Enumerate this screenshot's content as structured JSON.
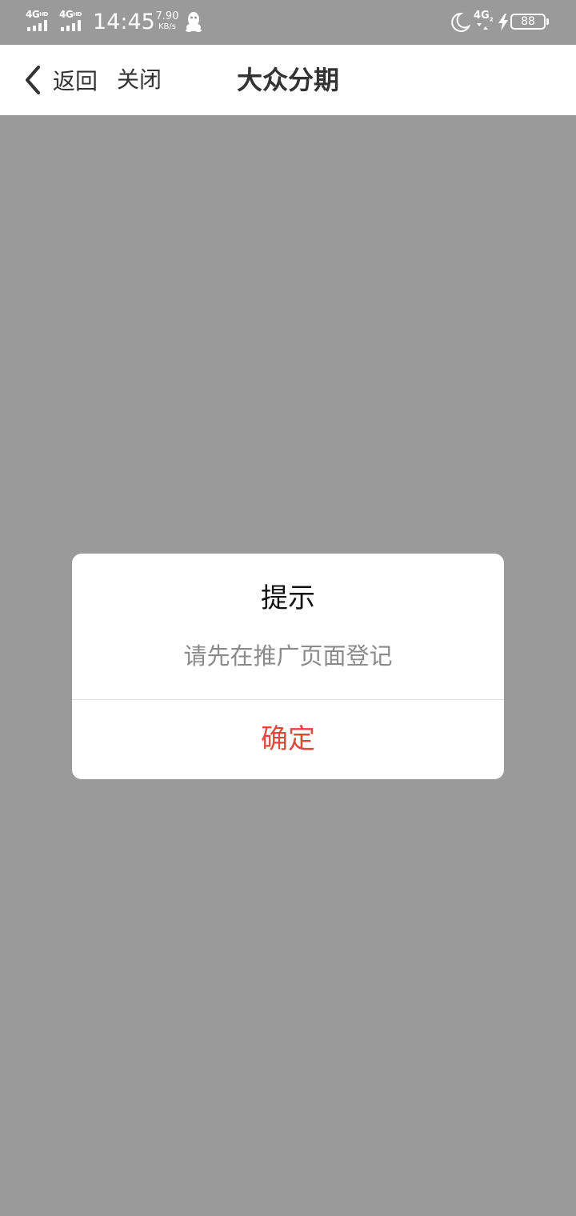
{
  "status_bar": {
    "sim1_label": "4G",
    "sim1_sup": "HD",
    "sim2_label": "4G",
    "sim2_sup": "HD",
    "time": "14:45",
    "speed_value": "7.90",
    "speed_unit": "KB/s",
    "notification_icon": "qq-penguin-icon",
    "dnd_icon": "moon-icon",
    "network_label": "4G",
    "network_sub": "2",
    "charging_icon": "bolt-icon",
    "battery_level": "88"
  },
  "nav": {
    "back_label": "返回",
    "close_label": "关闭",
    "title": "大众分期"
  },
  "dialog": {
    "title": "提示",
    "message": "请先在推广页面登记",
    "confirm_label": "确定",
    "confirm_color": "#e0483d"
  },
  "colors": {
    "overlay": "#9a9a9a",
    "nav_background": "#ffffff",
    "text_primary": "#333333",
    "text_secondary": "#8a8a8a"
  }
}
